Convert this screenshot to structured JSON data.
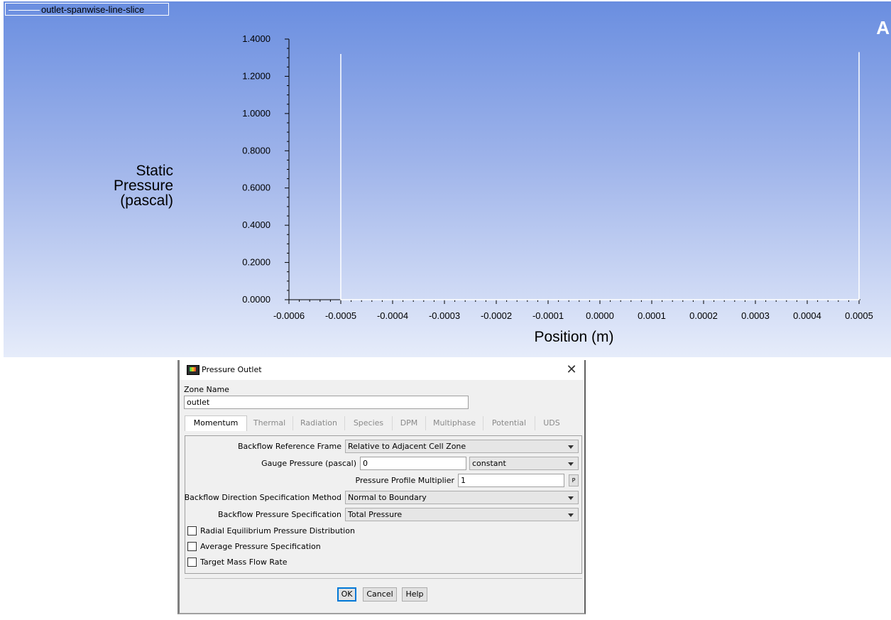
{
  "plot": {
    "legend_label": "outlet-spanwise-line-slice",
    "corner_letter": "A"
  },
  "chart_data": {
    "type": "line",
    "title": "",
    "xlabel": "Position (m)",
    "ylabel_lines": [
      "Static",
      "Pressure",
      "(pascal)"
    ],
    "xlim": [
      -0.0006,
      0.0005
    ],
    "ylim": [
      0.0,
      1.4
    ],
    "x_ticks": [
      "-0.0006",
      "-0.0005",
      "-0.0004",
      "-0.0003",
      "-0.0002",
      "-0.0001",
      "0.0000",
      "0.0001",
      "0.0002",
      "0.0003",
      "0.0004",
      "0.0005"
    ],
    "x_tick_values": [
      -0.0006,
      -0.0005,
      -0.0004,
      -0.0003,
      -0.0002,
      -0.0001,
      0.0,
      0.0001,
      0.0002,
      0.0003,
      0.0004,
      0.0005
    ],
    "y_ticks": [
      "0.0000",
      "0.2000",
      "0.4000",
      "0.6000",
      "0.8000",
      "1.0000",
      "1.2000",
      "1.4000"
    ],
    "y_tick_values": [
      0.0,
      0.2,
      0.4,
      0.6,
      0.8,
      1.0,
      1.2,
      1.4
    ],
    "series": [
      {
        "name": "outlet-spanwise-line-slice",
        "color": "#ffffff",
        "x": [
          -0.0005,
          -0.0005,
          0.0005,
          0.0005
        ],
        "y": [
          1.32,
          0.0,
          0.0,
          1.33
        ]
      }
    ],
    "grid": false,
    "legend_position": "top-left"
  },
  "dialog": {
    "title": "Pressure Outlet",
    "zone_name_label": "Zone Name",
    "zone_name_value": "outlet",
    "tabs": [
      "Momentum",
      "Thermal",
      "Radiation",
      "Species",
      "DPM",
      "Multiphase",
      "Potential",
      "UDS"
    ],
    "active_tab": "Momentum",
    "backflow_reference_frame_label": "Backflow Reference Frame",
    "backflow_reference_frame_value": "Relative to Adjacent Cell Zone",
    "gauge_pressure_label": "Gauge Pressure (pascal)",
    "gauge_pressure_value": "0",
    "gauge_pressure_method": "constant",
    "pressure_profile_multiplier_label": "Pressure Profile Multiplier",
    "pressure_profile_multiplier_value": "1",
    "p_button_label": "P",
    "backflow_direction_label": "Backflow Direction Specification Method",
    "backflow_direction_value": "Normal to Boundary",
    "backflow_pressure_label": "Backflow Pressure Specification",
    "backflow_pressure_value": "Total Pressure",
    "checkboxes": [
      {
        "label": "Radial Equilibrium Pressure Distribution",
        "checked": false
      },
      {
        "label": "Average Pressure Specification",
        "checked": false
      },
      {
        "label": "Target Mass Flow Rate",
        "checked": false
      }
    ],
    "ok_label": "OK",
    "cancel_label": "Cancel",
    "help_label": "Help"
  }
}
